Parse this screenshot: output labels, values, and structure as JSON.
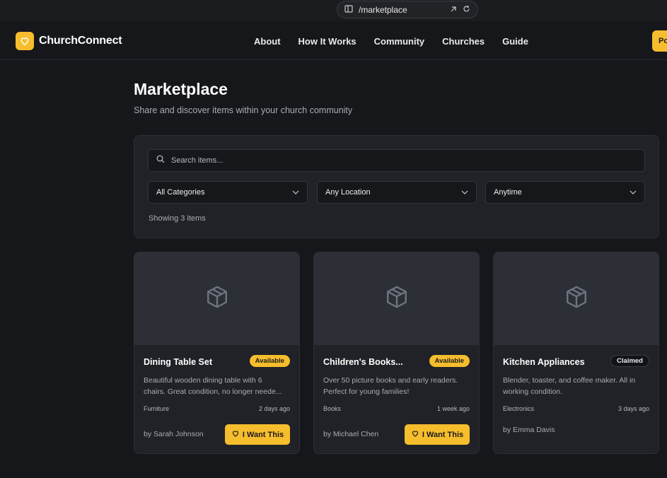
{
  "browser": {
    "url": "/marketplace"
  },
  "nav": {
    "brand": "ChurchConnect",
    "links": [
      "About",
      "How It Works",
      "Community",
      "Churches",
      "Guide"
    ],
    "cta_label": "Po"
  },
  "page": {
    "title": "Marketplace",
    "subtitle": "Share and discover items within your church community"
  },
  "filters": {
    "search_placeholder": "Search items...",
    "category": "All Categories",
    "location": "Any Location",
    "time": "Anytime",
    "showing_text": "Showing 3 items"
  },
  "items": [
    {
      "title": "Dining Table Set",
      "status": "Available",
      "desc_line1": "Beautiful wooden dining table with 6",
      "desc_line2": "chairs. Great condition, no longer neede...",
      "category": "Furniture",
      "time": "2 days ago",
      "owner": "by Sarah Johnson",
      "action": "I Want This"
    },
    {
      "title": "Children's Books...",
      "status": "Available",
      "desc_line1": "Over 50 picture books and early readers.",
      "desc_line2": "Perfect for young families!",
      "category": "Books",
      "time": "1 week ago",
      "owner": "by Michael Chen",
      "action": "I Want This"
    },
    {
      "title": "Kitchen Appliances",
      "status": "Claimed",
      "desc_line1": "Blender, toaster, and coffee maker. All in",
      "desc_line2": "working condition.",
      "category": "Electronics",
      "time": "3 days ago",
      "owner": "by Emma Davis"
    }
  ],
  "colors": {
    "accent": "#f6bd2c",
    "background": "#16171b",
    "panel": "#202227",
    "image_placeholder": "#2c2f36"
  },
  "icons": [
    "reader-mode-icon",
    "heart-icon",
    "search-icon",
    "chevron-down-icon",
    "package-icon",
    "external-link-icon",
    "reload-icon"
  ]
}
